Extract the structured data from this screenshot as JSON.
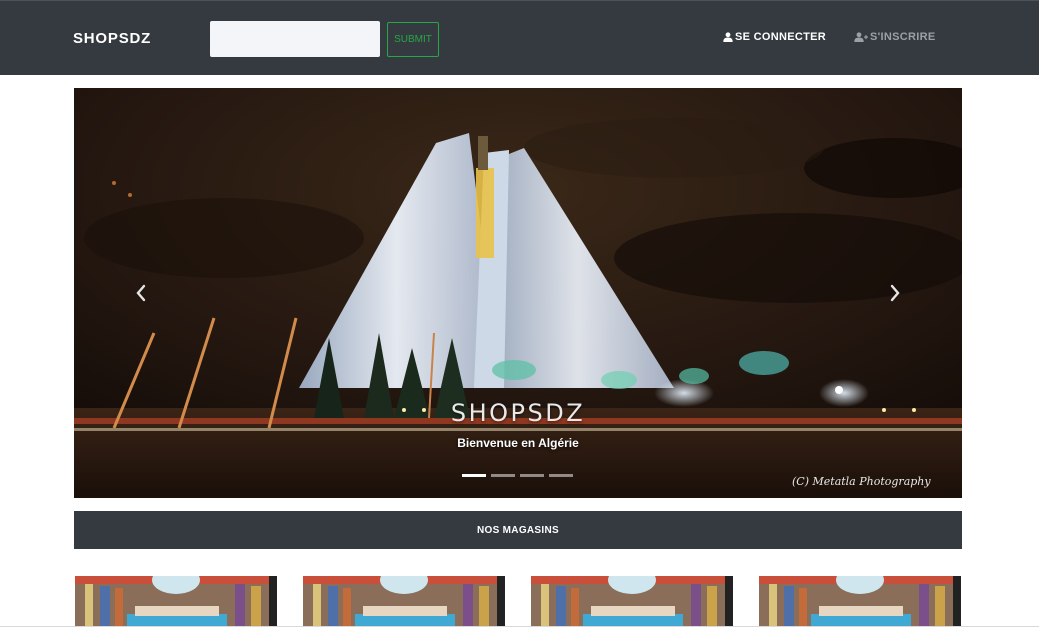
{
  "navbar": {
    "brand": "SHOPSDZ",
    "search": {
      "value": "",
      "placeholder": ""
    },
    "submit_label": "SUBMIT",
    "login": {
      "label": "SE CONNECTER",
      "icon": "user-icon"
    },
    "register": {
      "label": "S'INSCRIRE",
      "icon": "user-plus-icon"
    }
  },
  "carousel": {
    "caption_title": "SHOPSDZ",
    "caption_text": "Bienvenue en Algérie",
    "watermark": "(C) Metatla Photography",
    "prev_icon": "chevron-left-icon",
    "next_icon": "chevron-right-icon",
    "active_slide": 1,
    "slide_count": 4
  },
  "section": {
    "title": "NOS MAGASINS"
  },
  "stores": {
    "count": 4
  },
  "colors": {
    "navbar_bg": "#343a40",
    "accent_green": "#28a745",
    "muted_link": "#9aa0a6"
  }
}
